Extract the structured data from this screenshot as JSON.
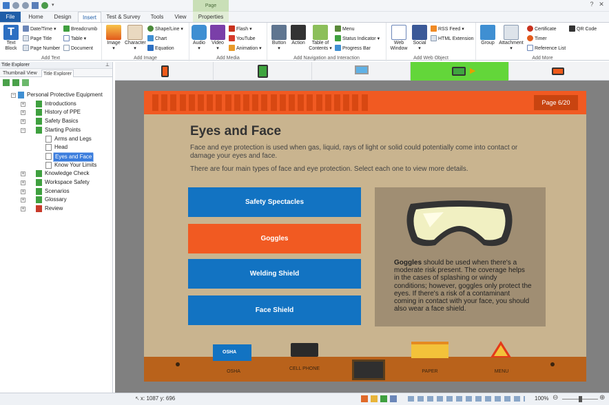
{
  "window": {
    "context_tab": "Page",
    "help_btn": "?",
    "close_btn": "✕"
  },
  "tabs": [
    "File",
    "Home",
    "Design",
    "Insert",
    "Test & Survey",
    "Tools",
    "View",
    "Properties"
  ],
  "ribbon": {
    "groups": {
      "add_text": "Add Text",
      "add_image": "Add Image",
      "add_media": "Add Media",
      "add_nav": "Add Navigation and Interaction",
      "add_web": "Add Web Object",
      "add_more": "Add More"
    },
    "text_block": "Text Block",
    "date_time": "Date/Time",
    "page_title": "Page Title",
    "page_number": "Page Number",
    "breadcrumb": "Breadcrumb",
    "table": "Table",
    "document": "Document",
    "image": "Image",
    "character": "Character",
    "shape_line": "Shape/Line",
    "chart": "Chart",
    "equation": "Equation",
    "audio": "Audio",
    "video": "Video",
    "flash": "Flash",
    "youtube": "YouTube",
    "animation": "Animation",
    "button": "Button",
    "action": "Action",
    "table_of_contents": "Table of Contents",
    "menu": "Menu",
    "status_indicator": "Status Indicator",
    "progress_bar": "Progress Bar",
    "web_window": "Web Window",
    "social": "Social",
    "rss_feed": "RSS Feed",
    "html_extension": "HTML Extension",
    "group": "Group",
    "attachment": "Attachment",
    "certificate": "Certificate",
    "timer": "Timer",
    "reference_list": "Reference List",
    "qr_code": "QR Code"
  },
  "left_panel": {
    "title": "Title Explorer",
    "tabs": [
      "Thumbnail View",
      "Title Explorer"
    ],
    "tree": [
      {
        "label": "Personal Protective Equipment",
        "level": 0,
        "expander": "-",
        "icon": "title"
      },
      {
        "label": "Introductions",
        "level": 1,
        "expander": "+",
        "icon": "chapter"
      },
      {
        "label": "History of PPE",
        "level": 1,
        "expander": "+",
        "icon": "chapter"
      },
      {
        "label": "Safety Basics",
        "level": 1,
        "expander": "+",
        "icon": "chapter"
      },
      {
        "label": "Starting Points",
        "level": 1,
        "expander": "-",
        "icon": "chapter"
      },
      {
        "label": "Arms and Legs",
        "level": 2,
        "expander": "",
        "icon": "page"
      },
      {
        "label": "Head",
        "level": 2,
        "expander": "",
        "icon": "page"
      },
      {
        "label": "Eyes and Face",
        "level": 2,
        "expander": "",
        "icon": "page",
        "selected": true
      },
      {
        "label": "Know Your Limits",
        "level": 2,
        "expander": "",
        "icon": "page"
      },
      {
        "label": "Knowledge Check",
        "level": 1,
        "expander": "+",
        "icon": "chapter"
      },
      {
        "label": "Workspace Safety",
        "level": 1,
        "expander": "+",
        "icon": "chapter"
      },
      {
        "label": "Scenarios",
        "level": 1,
        "expander": "+",
        "icon": "chapter"
      },
      {
        "label": "Glossary",
        "level": 1,
        "expander": "+",
        "icon": "chapter"
      },
      {
        "label": "Review",
        "level": 1,
        "expander": "+",
        "icon": "test"
      }
    ]
  },
  "devices": [
    "phone-portrait-icon",
    "tablet-portrait-icon",
    "desktop-icon",
    "tablet-landscape-icon",
    "phone-landscape-icon"
  ],
  "slide": {
    "page_badge": "Page 6/20",
    "title": "Eyes and Face",
    "intro": "Face and eye protection is used when gas, liquid, rays of light or solid could potentially come into contact or damage your eyes and face.",
    "intro2": "There are four main types of face and eye protection. Select each one to view more details.",
    "options": [
      {
        "label": "Safety Spectacles",
        "color": "#1273c2"
      },
      {
        "label": "Goggles",
        "color": "#f15a22"
      },
      {
        "label": "Welding Shield",
        "color": "#1273c2"
      },
      {
        "label": "Face Shield",
        "color": "#1273c2"
      }
    ],
    "detail_bold": "Goggles",
    "detail_text": " should be used when there's a moderate risk present. The coverage helps in the cases of splashing or windy conditions; however, goggles only protect the eyes. If there's a risk of a contaminant coming in contact with your face, you should also wear a face shield.",
    "footer": {
      "osha_book": "OSHA",
      "osha": "OSHA",
      "cell": "CELL PHONE",
      "paper": "PAPER",
      "menu": "MENU"
    }
  },
  "status": {
    "coords": "x: 1087  y: 696",
    "zoom": "100%"
  },
  "colors": {
    "accent_blue": "#1f5ea8",
    "slide_orange": "#f15a22",
    "slide_blue": "#1273c2",
    "slide_bg": "#c9b48f",
    "device_active": "#63d63a"
  }
}
